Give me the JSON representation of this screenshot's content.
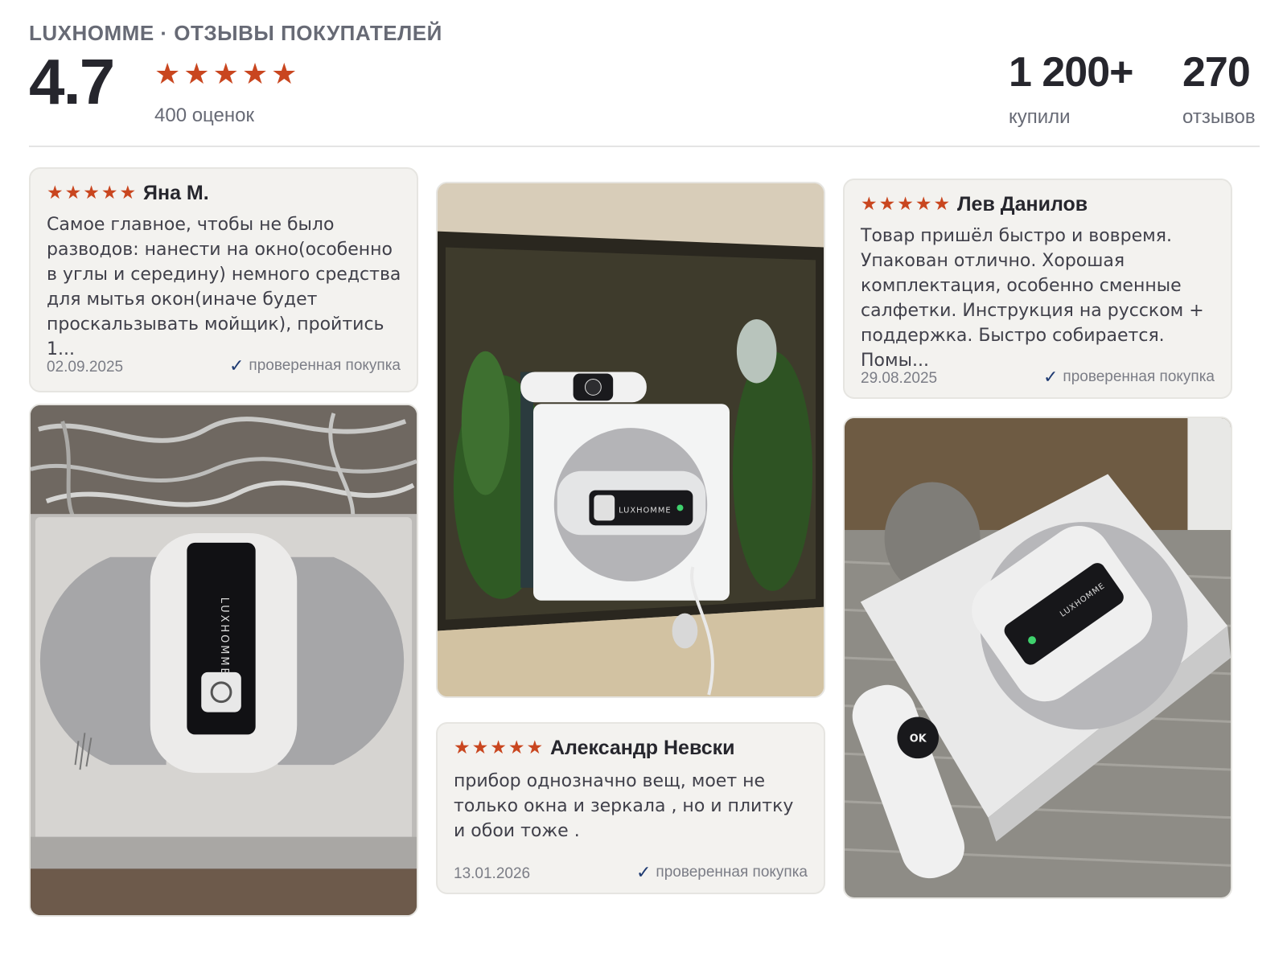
{
  "header": {
    "brand_line": "LUXHOMME · ОТЗЫВЫ ПОКУПАТЕЛЕЙ",
    "score": "4.7",
    "stars": 5,
    "ratings_count": "400 оценок",
    "stats": [
      {
        "value": "1 200+",
        "label": "купили"
      },
      {
        "value": "270",
        "label": "отзывов"
      }
    ]
  },
  "reviews": [
    {
      "author": "Яна М.",
      "stars": 5,
      "text": "Самое главное, чтобы не было разводов: нанести на окно(особенно в углы и середину) немного средства для мытья окон(иначе будет проскальзывать мойщик), пройтись 1...",
      "date": "02.09.2025",
      "verified": "проверенная покупка"
    },
    {
      "author": "Александр Невски",
      "stars": 5,
      "text": "прибор однозначно вещ, моет не только окна и зеркала , но и плитку и обои тоже .",
      "date": "13.01.2026",
      "verified": "проверенная покупка"
    },
    {
      "author": "Лев Данилов",
      "stars": 5,
      "text": "Товар пришёл быстро и вовремя. Упакован отлично. Хорошая комплектация, особенно сменные салфетки. Инструкция на русском + поддержка. Быстро собирается. Помы...",
      "date": "29.08.2025",
      "verified": "проверенная покупка"
    }
  ],
  "photos": {
    "left_logo": "LUXHOMME",
    "middle_logo": "LUXHOMME",
    "right_logo": "LUXHOMME",
    "remote_ok": "OK"
  },
  "colors": {
    "star": "#c9461f",
    "check": "#1f3b72",
    "card_bg": "#f3f2ef"
  }
}
